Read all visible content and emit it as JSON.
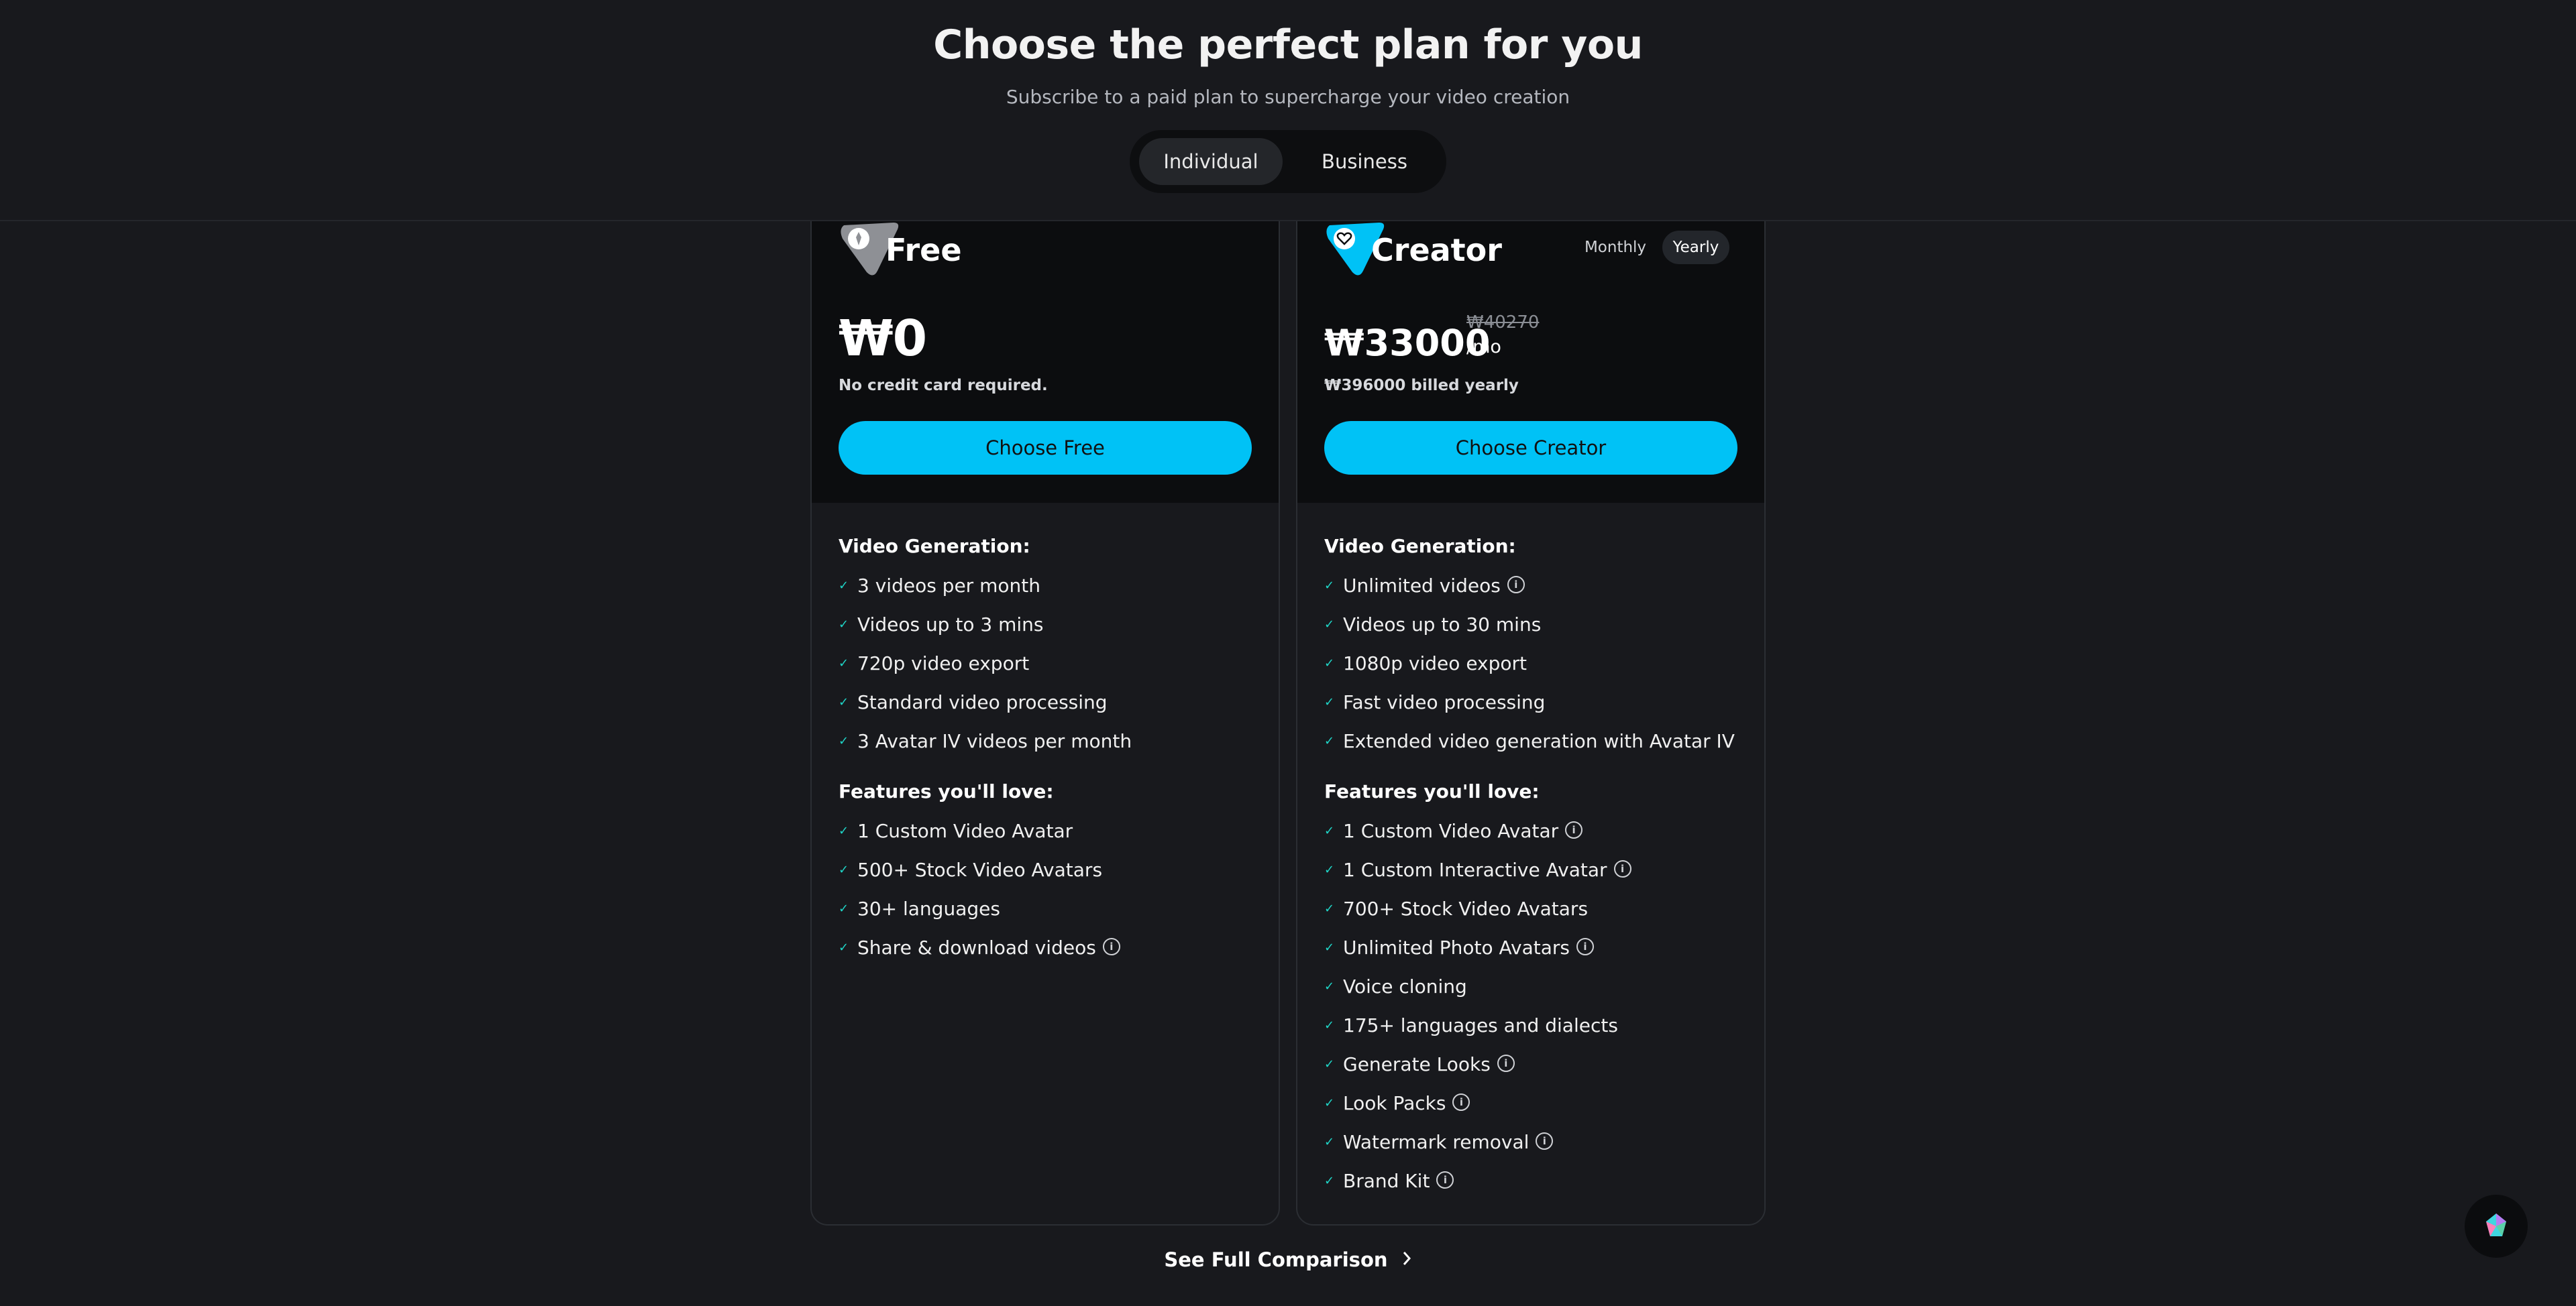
{
  "header": {
    "title": "Choose the perfect plan for you",
    "subtitle": "Subscribe to a paid plan to supercharge your video creation",
    "tabs": [
      {
        "label": "Individual",
        "active": true
      },
      {
        "label": "Business",
        "active": false
      }
    ]
  },
  "plans": {
    "free": {
      "name": "Free",
      "price": "₩0",
      "note": "No credit card required.",
      "cta": "Choose Free",
      "video_heading": "Video Generation:",
      "video_features": [
        "3 videos per month",
        "Videos up to 3 mins",
        "720p video export",
        "Standard video processing",
        "3 Avatar IV videos per month"
      ],
      "features_heading": "Features you'll love:",
      "features": [
        "1 Custom Video Avatar",
        "500+ Stock Video Avatars",
        "30+ languages",
        "Share & download videos"
      ]
    },
    "creator": {
      "name": "Creator",
      "billing_monthly": "Monthly",
      "billing_yearly": "Yearly",
      "price": "₩33000",
      "old_price": "₩40270",
      "per": "/mo",
      "note": "₩396000 billed yearly",
      "cta": "Choose Creator",
      "video_heading": "Video Generation:",
      "video_features": [
        "Unlimited videos",
        "Videos up to 30 mins",
        "1080p video export",
        "Fast video processing",
        "Extended video generation with Avatar IV"
      ],
      "features_heading": "Features you'll love:",
      "features": [
        "1 Custom Video Avatar",
        "1 Custom Interactive Avatar",
        "700+ Stock Video Avatars",
        "Unlimited Photo Avatars",
        "Voice cloning",
        "175+ languages and dialects",
        "Generate Looks",
        "Look Packs",
        "Watermark removal",
        "Brand Kit"
      ]
    }
  },
  "footer": {
    "comparison_link": "See Full Comparison"
  },
  "colors": {
    "accent": "#00c2f6",
    "check": "#1fd6c8",
    "background": "#18191d"
  }
}
